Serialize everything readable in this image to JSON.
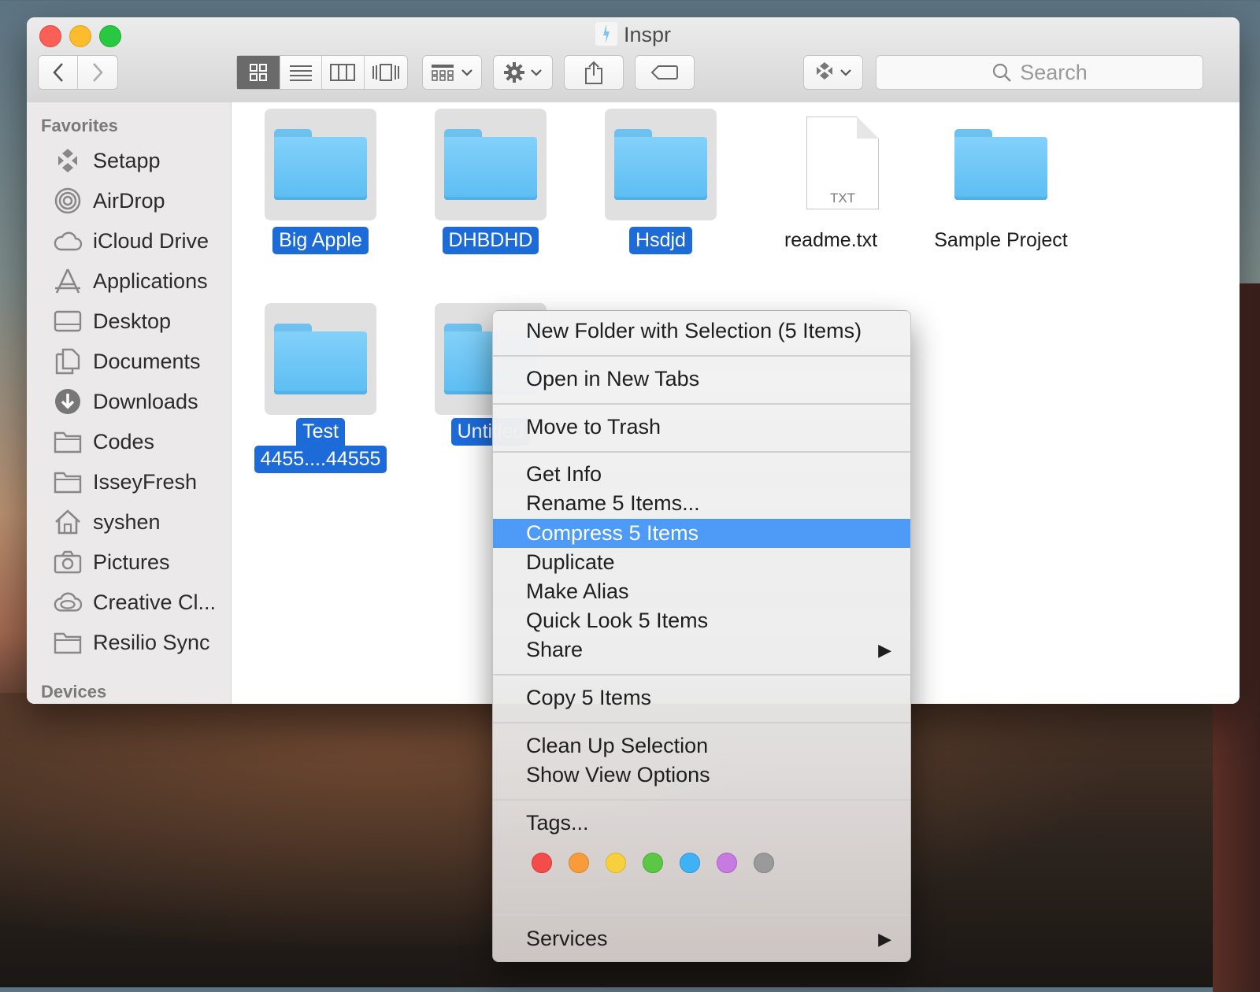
{
  "window": {
    "title": "Inspr"
  },
  "toolbar": {
    "search_placeholder": "Search",
    "views": [
      "icon-view",
      "list-view",
      "column-view",
      "cover-flow-view"
    ]
  },
  "sidebar": {
    "favorites_label": "Favorites",
    "devices_label": "Devices",
    "items": [
      {
        "label": "Setapp",
        "icon": "setapp-icon"
      },
      {
        "label": "AirDrop",
        "icon": "airdrop-icon"
      },
      {
        "label": "iCloud Drive",
        "icon": "cloud-icon"
      },
      {
        "label": "Applications",
        "icon": "applications-icon"
      },
      {
        "label": "Desktop",
        "icon": "desktop-icon"
      },
      {
        "label": "Documents",
        "icon": "documents-icon"
      },
      {
        "label": "Downloads",
        "icon": "download-icon"
      },
      {
        "label": "Codes",
        "icon": "folder-icon"
      },
      {
        "label": "IsseyFresh",
        "icon": "folder-icon"
      },
      {
        "label": "syshen",
        "icon": "home-icon"
      },
      {
        "label": "Pictures",
        "icon": "camera-icon"
      },
      {
        "label": "Creative Cl...",
        "icon": "creative-cloud-icon"
      },
      {
        "label": "Resilio Sync",
        "icon": "folder-icon"
      }
    ]
  },
  "files": [
    {
      "name": "Big Apple",
      "kind": "folder",
      "selected": true
    },
    {
      "name": "DHBDHD",
      "kind": "folder",
      "selected": true
    },
    {
      "name": "Hsdjd",
      "kind": "folder",
      "selected": true
    },
    {
      "name": "readme.txt",
      "kind": "text",
      "ext": "TXT",
      "selected": false
    },
    {
      "name": "Sample Project",
      "kind": "folder",
      "selected": false
    },
    {
      "name_line1": "Test",
      "name_line2": "4455....44555",
      "kind": "folder",
      "selected": true
    },
    {
      "name": "Untitled",
      "kind": "folder",
      "selected": true
    }
  ],
  "context_menu": {
    "items": [
      "New Folder with Selection (5 Items)",
      "Open in New Tabs",
      "Move to Trash",
      "Get Info",
      "Rename 5 Items...",
      "Compress 5 Items",
      "Duplicate",
      "Make Alias",
      "Quick Look 5 Items",
      "Share",
      "Copy 5 Items",
      "Clean Up Selection",
      "Show View Options",
      "Tags...",
      "Services"
    ],
    "highlighted": "Compress 5 Items",
    "tag_colors": [
      "#f44b4b",
      "#f89b3b",
      "#f7d13d",
      "#5cc745",
      "#3fb2f5",
      "#c77ae0",
      "#9a9a9a"
    ]
  }
}
